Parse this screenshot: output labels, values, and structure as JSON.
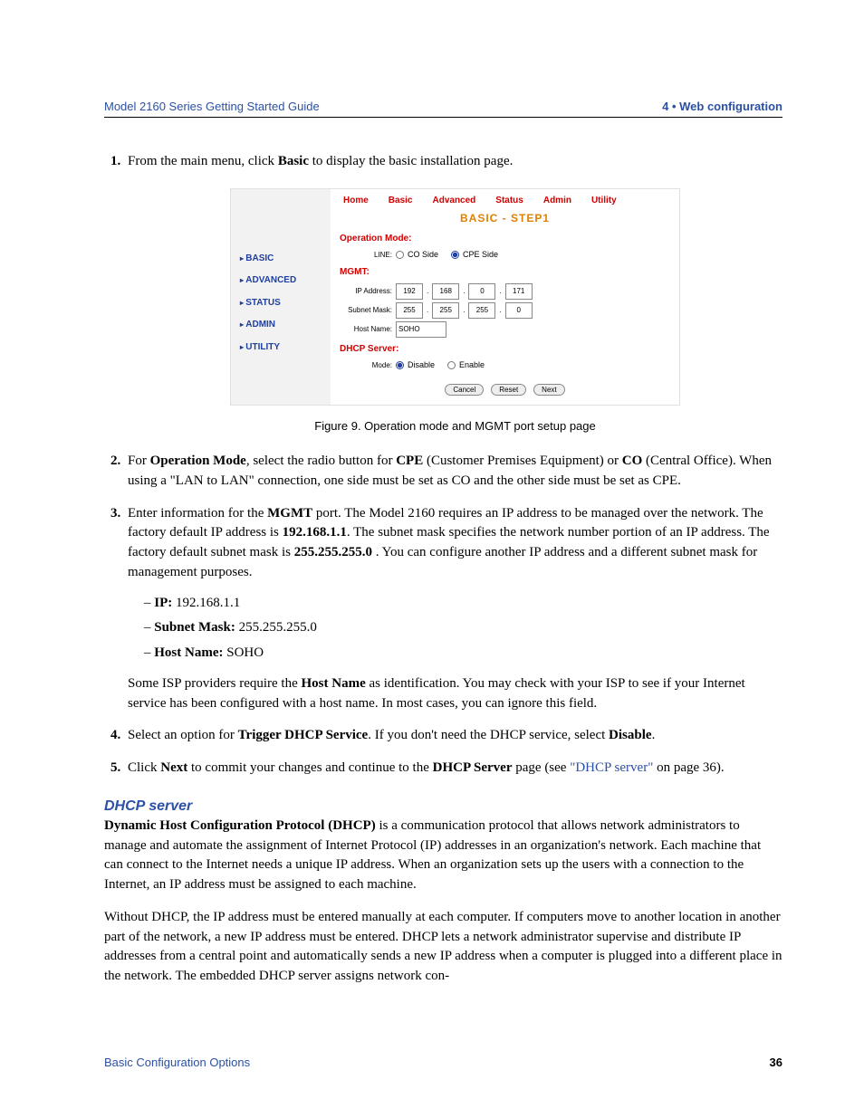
{
  "header": {
    "left": "Model 2160 Series Getting Started Guide",
    "right": "4 • Web configuration"
  },
  "steps": {
    "s1_pre": "From the main menu, click ",
    "s1_bold": "Basic",
    "s1_post": " to display the basic installation page.",
    "caption": "Figure 9. Operation mode and MGMT port setup page",
    "s2": {
      "pre": "For ",
      "b1": "Operation Mode",
      "mid1": ", select the radio button for ",
      "b2": "CPE",
      "mid2": " (Customer Premises Equipment) or ",
      "b3": "CO",
      "post": " (Central Office). When using a \"LAN to LAN\" connection, one side must be set as CO and the other side must be set as CPE."
    },
    "s3": {
      "pre": "Enter information for the ",
      "b1": "MGMT",
      "mid1": " port. The Model 2160 requires an IP address to be managed over the network. The factory default IP address is ",
      "b2": "192.168.1.1",
      "mid2": ". The subnet mask specifies the network number portion of an IP address. The factory default subnet mask is ",
      "b3": "255.255.255.0",
      "post": " . You can configure another IP address and a different subnet mask for management purposes."
    },
    "bullets": {
      "ip_k": "IP:",
      "ip_v": " 192.168.1.1",
      "sm_k": "Subnet Mask:",
      "sm_v": " 255.255.255.0",
      "hn_k": "Host Name:",
      "hn_v": " SOHO"
    },
    "s3_tail_pre": "Some ISP providers require the ",
    "s3_tail_b": "Host Name",
    "s3_tail_post": " as identification. You may check with your ISP to see if your Internet service has been configured with a host name. In most cases, you can ignore this field.",
    "s4_pre": "Select an option for ",
    "s4_b1": "Trigger DHCP Service",
    "s4_mid": ". If you don't need the DHCP service, select ",
    "s4_b2": "Disable",
    "s4_post": ".",
    "s5_pre": "Click ",
    "s5_b1": "Next",
    "s5_mid": " to commit your changes and continue to the ",
    "s5_b2": "DHCP Server",
    "s5_post1": " page (see ",
    "s5_link": "\"DHCP server\"",
    "s5_post2": " on page 36)."
  },
  "dhcp": {
    "heading": "DHCP server",
    "p1_b": "Dynamic Host Configuration Protocol (DHCP)",
    "p1_rest": " is a communication protocol that allows network administrators to manage and automate the assignment of Internet Protocol (IP) addresses in an organization's network. Each machine that can connect to the Internet needs a unique IP address. When an organization sets up the users with a connection to the Internet, an IP address must be assigned to each machine.",
    "p2": "Without DHCP, the IP address must be entered manually at each computer. If computers move to another location in another part of the network, a new IP address must be entered. DHCP lets a network administrator supervise and distribute IP addresses from a central point and automatically sends a new IP address when a computer is plugged into a different place in the network. The embedded DHCP server assigns network con-"
  },
  "footer": {
    "left": "Basic Configuration Options",
    "page": "36"
  },
  "screenshot": {
    "sidebar": [
      "BASIC",
      "ADVANCED",
      "STATUS",
      "ADMIN",
      "UTILITY"
    ],
    "tabs": [
      "Home",
      "Basic",
      "Advanced",
      "Status",
      "Admin",
      "Utility"
    ],
    "title": "BASIC - STEP1",
    "opmode_label": "Operation Mode:",
    "line_label": "LINE:",
    "line_co": "CO Side",
    "line_cpe": "CPE Side",
    "mgmt_label": "MGMT:",
    "ip_label": "IP Address:",
    "ip": [
      "192",
      "168",
      "0",
      "171"
    ],
    "sm_label": "Subnet Mask:",
    "sm": [
      "255",
      "255",
      "255",
      "0"
    ],
    "hn_label": "Host Name:",
    "hn": "SOHO",
    "dhcp_label": "DHCP Server:",
    "mode_label": "Mode:",
    "mode_dis": "Disable",
    "mode_en": "Enable",
    "btn_cancel": "Cancel",
    "btn_reset": "Reset",
    "btn_next": "Next"
  }
}
